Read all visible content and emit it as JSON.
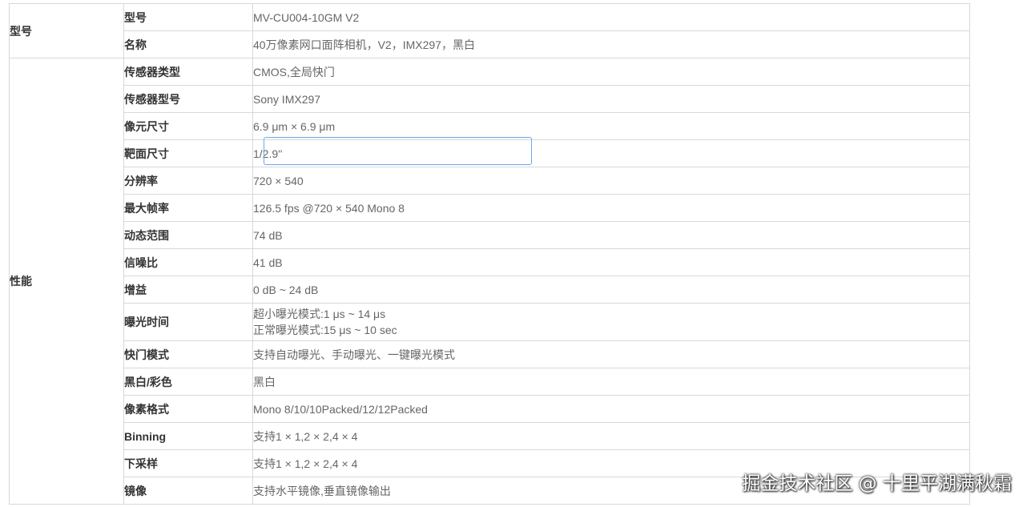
{
  "groups": {
    "model": "型号",
    "performance": "性能"
  },
  "rows": [
    {
      "label": "型号",
      "value": "MV-CU004-10GM V2"
    },
    {
      "label": "名称",
      "value": "40万像素网口面阵相机，V2，IMX297，黑白"
    },
    {
      "label": "传感器类型",
      "value": "CMOS,全局快门"
    },
    {
      "label": "传感器型号",
      "value": "Sony IMX297"
    },
    {
      "label": "像元尺寸",
      "value": "6.9 μm × 6.9 μm"
    },
    {
      "label": "靶面尺寸",
      "value": "1/2.9''"
    },
    {
      "label": "分辨率",
      "value": "720 × 540"
    },
    {
      "label": "最大帧率",
      "value": "126.5 fps @720 × 540 Mono 8"
    },
    {
      "label": "动态范围",
      "value": "74 dB"
    },
    {
      "label": "信噪比",
      "value": "41 dB"
    },
    {
      "label": "增益",
      "value": "0 dB ~ 24 dB"
    },
    {
      "label": "曝光时间",
      "value_line1": "超小曝光模式:1 μs ~ 14 μs",
      "value_line2": "正常曝光模式:15 μs ~ 10 sec"
    },
    {
      "label": "快门模式",
      "value": "支持自动曝光、手动曝光、一键曝光模式"
    },
    {
      "label": "黑白/彩色",
      "value": "黑白"
    },
    {
      "label": "像素格式",
      "value": "Mono 8/10/10Packed/12/12Packed"
    },
    {
      "label": "Binning",
      "value": "支持1 × 1,2 × 2,4 × 4"
    },
    {
      "label": "下采样",
      "value": "支持1 × 1,2 × 2,4 × 4"
    },
    {
      "label": "镜像",
      "value": "支持水平镜像,垂直镜像输出"
    }
  ],
  "watermark": "掘金技术社区 @ 十里平湖满秋霜",
  "colors": {
    "border": "#d8d8d8",
    "focus_outline": "#6ea5e8"
  }
}
